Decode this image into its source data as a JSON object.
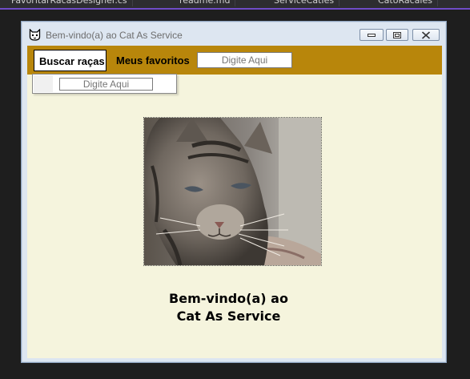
{
  "ide": {
    "tabs": [
      "FavoritarRacasDesigner.cs",
      "readme.md",
      "ServiceCatIes",
      "CatoRacaies"
    ],
    "accent_color": "#6f4cc7"
  },
  "window": {
    "title": "Bem-vindo(a) ao Cat As Service",
    "icon": "cat-icon",
    "controls": [
      "minimize-icon",
      "maximize-icon",
      "close-icon"
    ]
  },
  "menu": {
    "color": "#b8860b",
    "items": [
      {
        "label": "Buscar raças",
        "active": true
      },
      {
        "label": "Meus favoritos"
      }
    ],
    "search": {
      "placeholder": "Digite Aqui"
    }
  },
  "dropdown": {
    "search": {
      "placeholder": "Digite Aqui"
    }
  },
  "content": {
    "image": "cat-photo",
    "welcome_line1": "Bem-vindo(a) ao",
    "welcome_line2": "Cat As Service",
    "background": "#f5f4dd"
  }
}
